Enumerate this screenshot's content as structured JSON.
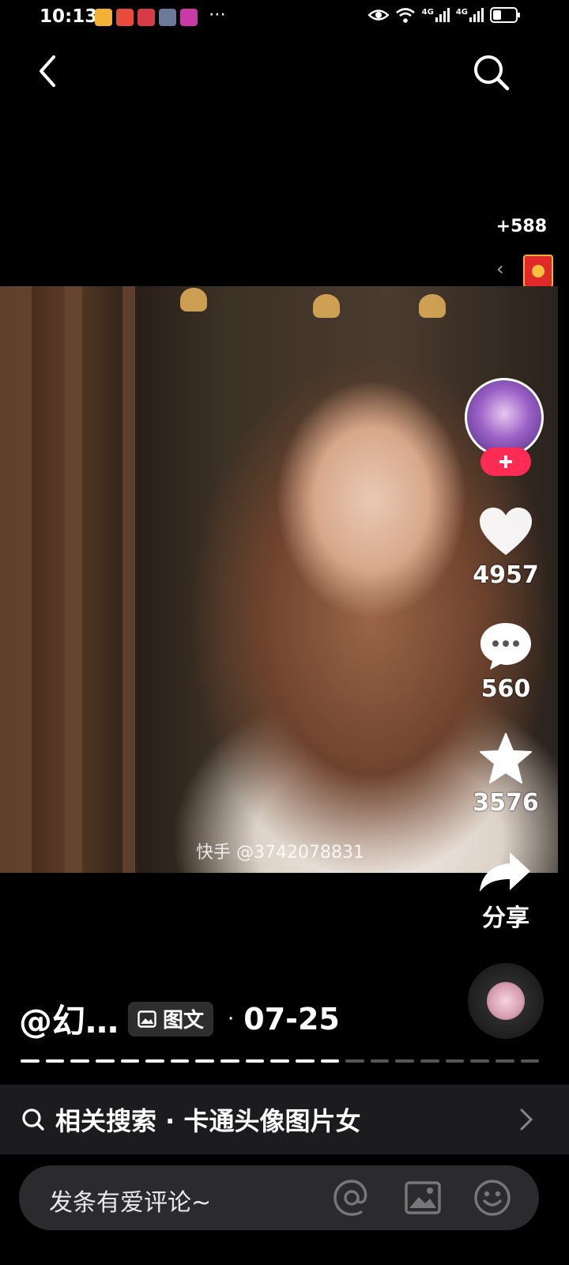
{
  "status_bar": {
    "time": "10:13",
    "signal_a": "4G",
    "signal_b": "4G"
  },
  "reward": {
    "count": "+588"
  },
  "watermark": "快手 @3742078831",
  "actions": {
    "like_count": "4957",
    "comment_count": "560",
    "favorite_count": "3576",
    "share_label": "分享"
  },
  "post": {
    "author": "@幻…",
    "type_tag": "图文",
    "separator": "·",
    "date": "07-25"
  },
  "carousel": {
    "total_pages": 21,
    "current_page": 13
  },
  "related": {
    "label": "相关搜索 · 卡通头像图片女"
  },
  "comment": {
    "placeholder": "发条有爱评论~"
  },
  "colors": {
    "follow": "#fe2c55",
    "background": "#000000"
  }
}
